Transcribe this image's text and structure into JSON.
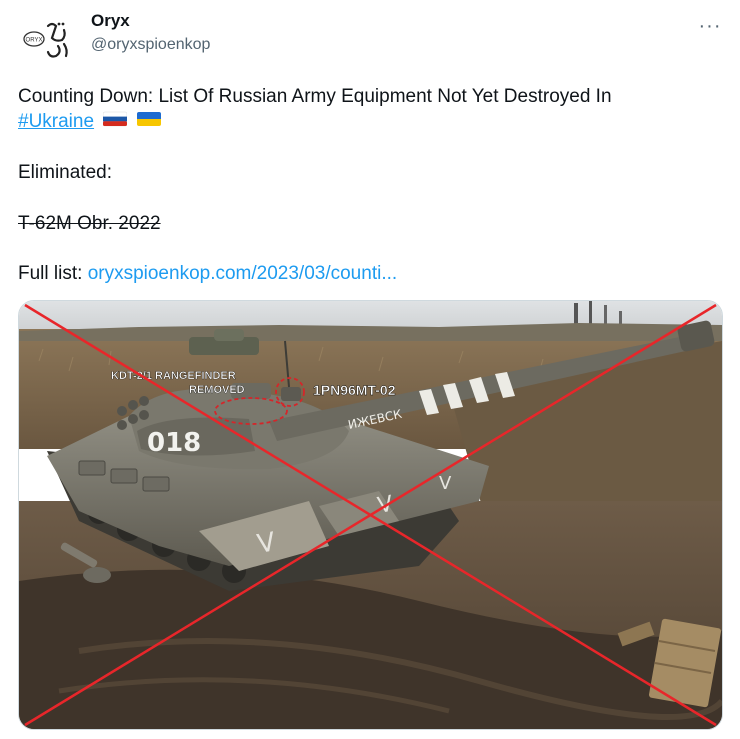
{
  "tweet": {
    "author_name": "Oryx",
    "author_handle": "@oryxspioenkop",
    "avatar_text": "ORYX",
    "more_label": "···",
    "line1": "Counting Down: List Of Russian Army Equipment Not Yet Destroyed In",
    "hashtag": "#Ukraine",
    "eliminated_label": "Eliminated:",
    "eliminated_item": "T-62M Obr. 2022",
    "full_list_label": "Full list: ",
    "full_list_link": "oryxspioenkop.com/2023/03/counti..."
  },
  "image": {
    "label_rangefinder_1": "KDT-2/1 RANGEFINDER",
    "label_rangefinder_2": "REMOVED",
    "label_sight": "1PN96MT-02",
    "turret_number": "018",
    "barrel_text": "ИЖЕВСК",
    "cross_color": "#e8262a"
  }
}
